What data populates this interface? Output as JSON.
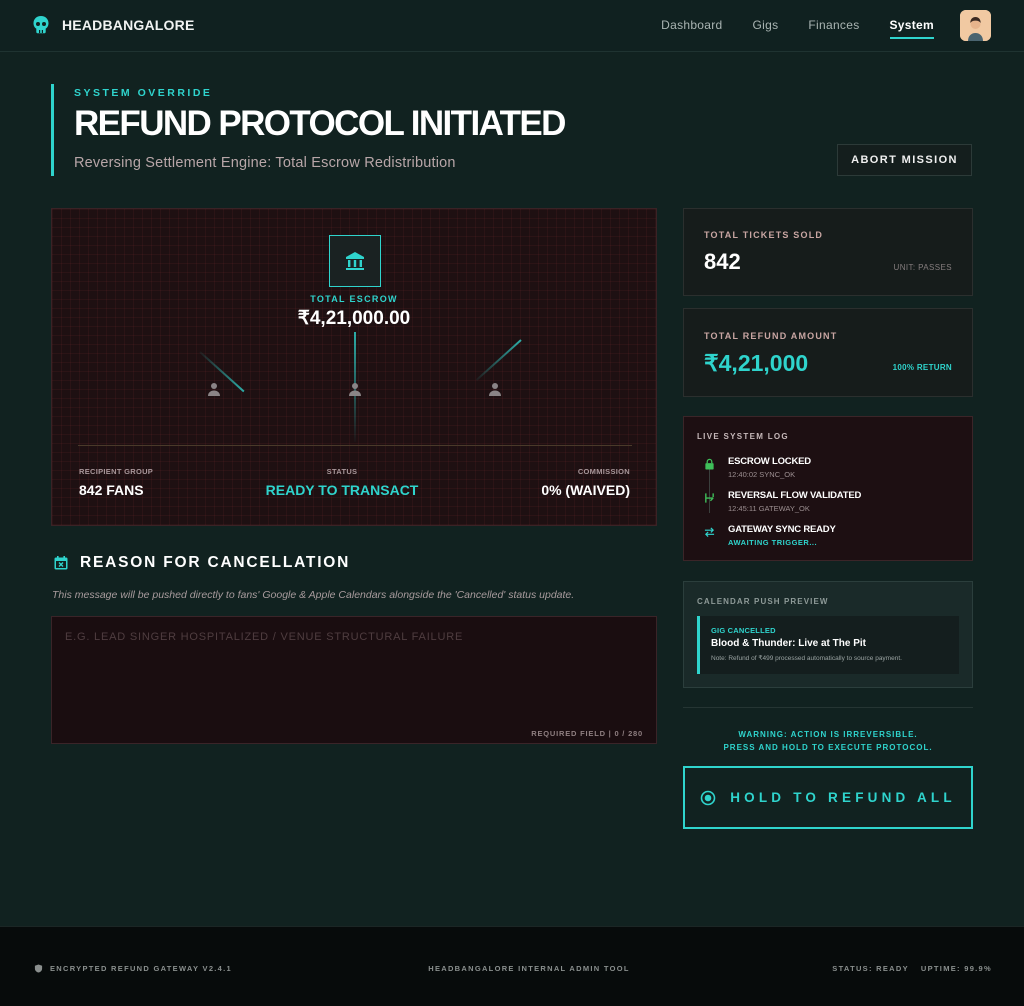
{
  "header": {
    "brand": "HEADBANGALORE",
    "nav": [
      {
        "label": "Dashboard",
        "active": false
      },
      {
        "label": "Gigs",
        "active": false
      },
      {
        "label": "Finances",
        "active": false
      },
      {
        "label": "System",
        "active": true
      }
    ]
  },
  "page": {
    "eyebrow": "SYSTEM OVERRIDE",
    "title": "REFUND PROTOCOL INITIATED",
    "subtitle": "Reversing Settlement Engine: Total Escrow Redistribution",
    "abort_label": "ABORT MISSION"
  },
  "escrow": {
    "label": "TOTAL ESCROW",
    "amount": "₹4,21,000.00",
    "recipient_label": "RECIPIENT GROUP",
    "recipient_value": "842 FANS",
    "status_label": "STATUS",
    "status_value": "READY TO TRANSACT",
    "commission_label": "COMMISSION",
    "commission_value": "0% (WAIVED)"
  },
  "tickets": {
    "label": "TOTAL TICKETS SOLD",
    "value": "842",
    "unit": "UNIT: PASSES"
  },
  "refund": {
    "label": "TOTAL REFUND AMOUNT",
    "value": "₹4,21,000",
    "note": "100% RETURN"
  },
  "log": {
    "label": "LIVE SYSTEM LOG",
    "items": [
      {
        "title": "ESCROW LOCKED",
        "sub": "12:40:02 SYNC_OK",
        "icon": "lock-icon"
      },
      {
        "title": "REVERSAL FLOW VALIDATED",
        "sub": "12:45:11 GATEWAY_OK",
        "icon": "flow-icon"
      },
      {
        "title": "GATEWAY SYNC READY",
        "sub": "AWAITING TRIGGER...",
        "icon": "sync-icon"
      }
    ]
  },
  "calendar": {
    "label": "CALENDAR PUSH PREVIEW",
    "tag": "GIG CANCELLED",
    "event": "Blood & Thunder: Live at The Pit",
    "note": "Note: Refund of ₹499 processed automatically to source payment."
  },
  "warning": {
    "line1": "WARNING: ACTION IS IRREVERSIBLE.",
    "line2": "PRESS AND HOLD TO EXECUTE PROTOCOL."
  },
  "hold_label": "HOLD TO REFUND ALL",
  "reason": {
    "title": "REASON FOR CANCELLATION",
    "note": "This message will be pushed directly to fans' Google & Apple Calendars alongside the 'Cancelled' status update.",
    "placeholder": "E.G. LEAD SINGER HOSPITALIZED / VENUE STRUCTURAL FAILURE",
    "requirement": "REQUIRED FIELD | 0 / 280"
  },
  "footer": {
    "left": "ENCRYPTED REFUND GATEWAY V2.4.1",
    "center": "HEADBANGALORE INTERNAL ADMIN TOOL",
    "status": "STATUS: READY",
    "uptime": "UPTIME: 99.9%"
  },
  "colors": {
    "accent": "#2fd4cd",
    "background": "#112220",
    "alert_panel": "#1e1012",
    "log_ok": "#3fbf5a"
  }
}
